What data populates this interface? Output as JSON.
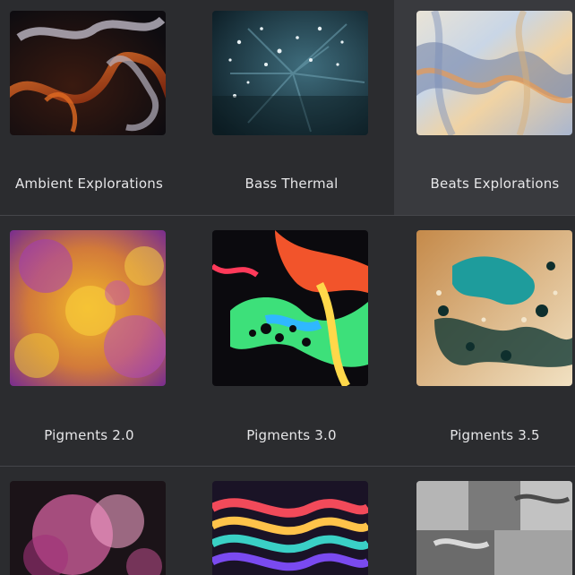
{
  "rows": [
    {
      "items": [
        {
          "label": "Ambient Explorations",
          "art": "smoke-fire-art",
          "selected": false
        },
        {
          "label": "Bass Thermal",
          "art": "teal-crystal-art",
          "selected": false
        },
        {
          "label": "Beats Explorations",
          "art": "iridescent-liquid-art",
          "selected": true
        }
      ]
    },
    {
      "items": [
        {
          "label": "Pigments 2.0",
          "art": "color-powder-art",
          "selected": false
        },
        {
          "label": "Pigments 3.0",
          "art": "neon-fluid-art",
          "selected": false
        },
        {
          "label": "Pigments 3.5",
          "art": "gold-teal-fluid-art",
          "selected": false
        }
      ]
    },
    {
      "items": [
        {
          "label": "",
          "art": "pink-smoke-art",
          "selected": false
        },
        {
          "label": "",
          "art": "rainbow-swirl-art",
          "selected": false
        },
        {
          "label": "",
          "art": "grayscale-collage-art",
          "selected": false
        }
      ]
    }
  ]
}
